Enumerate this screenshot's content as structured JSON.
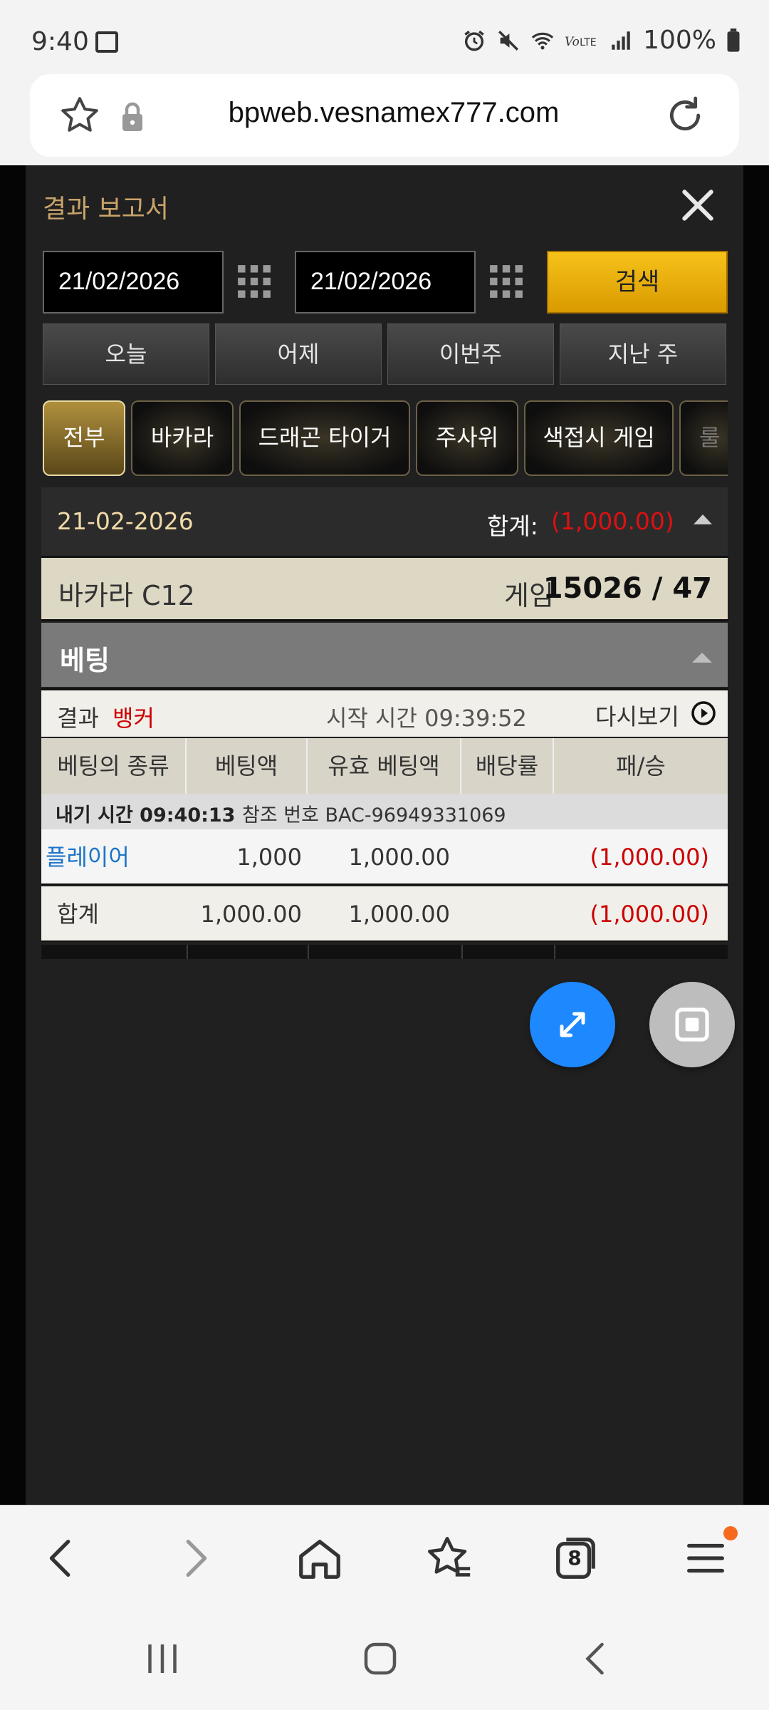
{
  "status_bar": {
    "time": "9:40",
    "battery": "100%"
  },
  "browser": {
    "url": "bpweb.vesnamex777.com",
    "tab_count": "8"
  },
  "report": {
    "title": "결과 보고서",
    "date_from": "21/02/2026",
    "date_to": "21/02/2026",
    "search_label": "검색",
    "ranges": [
      "오늘",
      "어제",
      "이번주",
      "지난 주"
    ],
    "game_tabs": [
      "전부",
      "바카라",
      "드래곤 타이거",
      "주사위",
      "색접시 게임",
      "룰"
    ],
    "active_tab": "전부"
  },
  "day": {
    "date": "21-02-2026",
    "total_label": "합계:",
    "total_value": "(1,000.00)"
  },
  "game": {
    "name": "바카라 C12",
    "label": "게임",
    "number": "15026 / 47"
  },
  "betting": {
    "title": "베팅",
    "result_label": "결과",
    "result_value": "뱅커",
    "start_time": "시작 시간 09:39:52",
    "replay_label": "다시보기",
    "columns": [
      "베팅의 종류",
      "베팅액",
      "유효 베팅액",
      "배당률",
      "패/승"
    ],
    "bet_time": "내기 시간 09:40:13",
    "reference": "참조 번호 BAC-96949331069",
    "rows": [
      {
        "type": "플레이어",
        "amount": "1,000",
        "valid": "1,000.00",
        "odds": "",
        "result": "(1,000.00)"
      }
    ],
    "total": {
      "label": "합계",
      "amount": "1,000.00",
      "valid": "1,000.00",
      "result": "(1,000.00)"
    }
  },
  "colors": {
    "accent_gold": "#f6c21a",
    "loss_red": "#cc0000",
    "link_blue": "#1b74c9",
    "fab_blue": "#1e88ff"
  }
}
